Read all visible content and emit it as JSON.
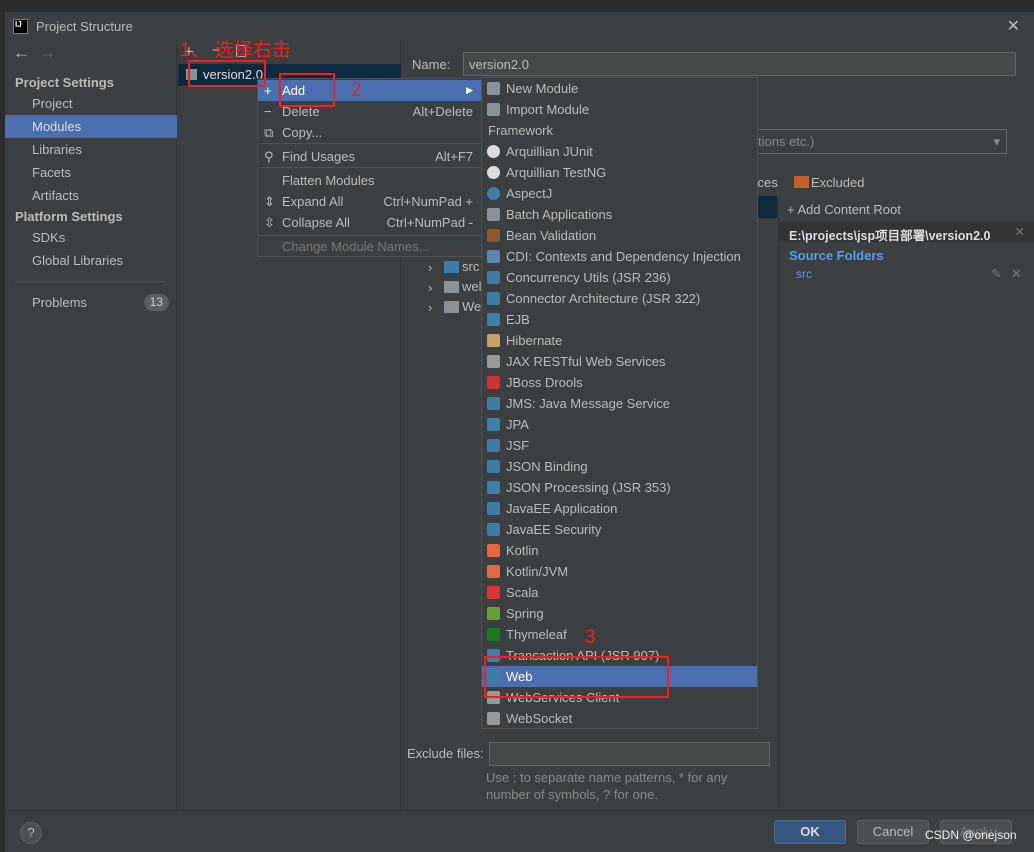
{
  "window": {
    "title": "Project Structure"
  },
  "sidebar": {
    "project_settings": "Project Settings",
    "items": [
      "Project",
      "Modules",
      "Libraries",
      "Facets",
      "Artifacts"
    ],
    "platform_settings": "Platform Settings",
    "platform_items": [
      "SDKs",
      "Global Libraries"
    ],
    "problems": "Problems",
    "problems_count": "13",
    "selected": "Modules"
  },
  "tree": {
    "module": "version2.0",
    "children": [
      "src",
      "wel",
      "We"
    ]
  },
  "context_menu": {
    "items": [
      {
        "label": "Add",
        "shortcut": ""
      },
      {
        "label": "Delete",
        "shortcut": "Alt+Delete"
      },
      {
        "label": "Copy...",
        "shortcut": ""
      },
      {
        "label": "Find Usages",
        "shortcut": "Alt+F7"
      },
      {
        "label": "Flatten Modules",
        "shortcut": ""
      },
      {
        "label": "Expand All",
        "shortcut": "Ctrl+NumPad +"
      },
      {
        "label": "Collapse All",
        "shortcut": "Ctrl+NumPad -"
      },
      {
        "label": "Change Module Names...",
        "shortcut": ""
      }
    ]
  },
  "submenu": {
    "items": [
      "New Module",
      "Import Module",
      "Framework",
      "Arquillian JUnit",
      "Arquillian TestNG",
      "AspectJ",
      "Batch Applications",
      "Bean Validation",
      "CDI: Contexts and Dependency Injection",
      "Concurrency Utils (JSR 236)",
      "Connector Architecture (JSR 322)",
      "EJB",
      "Hibernate",
      "JAX RESTful Web Services",
      "JBoss Drools",
      "JMS: Java Message Service",
      "JPA",
      "JSF",
      "JSON Binding",
      "JSON Processing (JSR 353)",
      "JavaEE Application",
      "JavaEE Security",
      "Kotlin",
      "Kotlin/JVM",
      "Scala",
      "Spring",
      "Thymeleaf",
      "Transaction API (JSR 907)",
      "Web",
      "WebServices Client",
      "WebSocket"
    ],
    "highlighted": "Web"
  },
  "details": {
    "name_label": "Name:",
    "name_value": "version2.0",
    "dropdown_value": "tions etc.)",
    "sources_partial": "urces",
    "excluded": "Excluded",
    "add_content_root": "+ Add Content Root",
    "content_root_path": "E:\\projects\\jsp项目部署\\version2.0",
    "source_folders": "Source Folders",
    "source_folder": "src",
    "exclude_label": "Exclude files:",
    "exclude_value": "",
    "hint": "Use ; to separate name patterns, * for any number of symbols, ? for one."
  },
  "buttons": {
    "ok": "OK",
    "cancel": "Cancel",
    "apply": "Apply"
  },
  "annotations": {
    "step1": "1、 选择右击",
    "step2": "2",
    "step3": "3"
  },
  "watermark": "CSDN @onejson"
}
